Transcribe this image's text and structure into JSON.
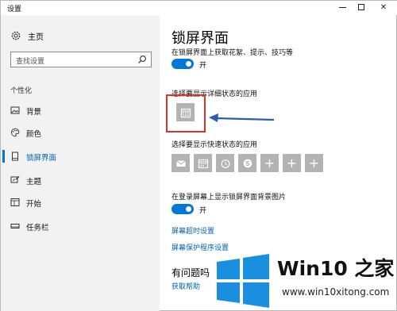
{
  "window": {
    "title": "设置",
    "min_label": "—",
    "close_label": "✕"
  },
  "sidebar": {
    "home_label": "主页",
    "search_placeholder": "查找设置",
    "section_label": "个性化",
    "items": [
      {
        "label": "背景",
        "icon": "image-icon",
        "active": false
      },
      {
        "label": "颜色",
        "icon": "palette-icon",
        "active": false
      },
      {
        "label": "锁屏界面",
        "icon": "lock-screen-icon",
        "active": true
      },
      {
        "label": "主题",
        "icon": "theme-icon",
        "active": false
      },
      {
        "label": "开始",
        "icon": "start-icon",
        "active": false
      },
      {
        "label": "任务栏",
        "icon": "taskbar-icon",
        "active": false
      }
    ]
  },
  "main": {
    "title": "锁屏界面",
    "fun_facts_label": "在锁屏界面上获取花絮、提示、技巧等",
    "toggle_on_label": "开",
    "detailed_status_label": "选择要显示详细状态的应用",
    "quick_status_label": "选择要显示快速状态的应用",
    "quick_status_tiles": [
      "mail-icon",
      "calendar-icon",
      "alarm-icon",
      "skype-icon",
      "plus-icon",
      "plus-icon",
      "plus-icon"
    ],
    "plus_glyph": "+",
    "signin_bg_label": "在登录屏幕上显示锁屏界面背景图片",
    "signin_toggle_label": "开",
    "screen_timeout_link": "屏幕超时设置",
    "screensaver_link": "屏幕保护程序设置",
    "question_title": "有问题吗",
    "get_help_link": "获取帮助"
  },
  "annotation": {
    "box_color": "#d9342b",
    "arrow_color": "#2a5fb0"
  },
  "watermark": {
    "title": "Win10 之家",
    "url": "www.win10xitong.com"
  },
  "colors": {
    "accent": "#0078d7",
    "link": "#0063b1",
    "tile": "#b3b3b3",
    "sidebar_bg": "#f2f2f2"
  }
}
